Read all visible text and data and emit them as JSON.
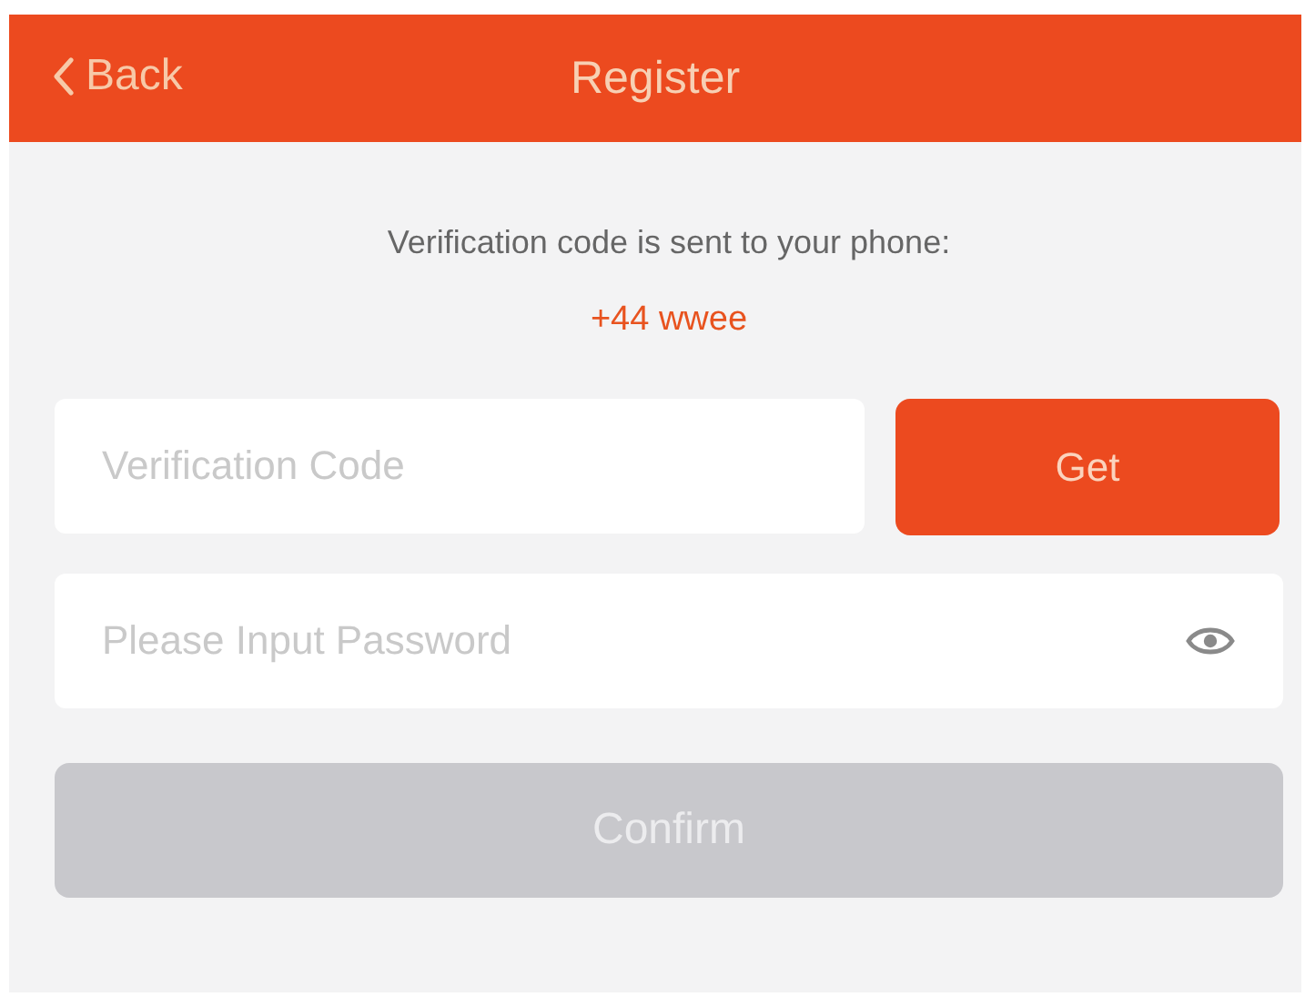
{
  "nav_bar": {
    "back_label": "Back",
    "title": "Register"
  },
  "message": "Verification code is sent to your phone:",
  "phone": "+44 wwee",
  "code_field": {
    "placeholder": "Verification Code"
  },
  "get_button": {
    "label": "Get",
    "disabled": false
  },
  "password_field": {
    "placeholder": "Please Input Password",
    "password_visible": false
  },
  "confirm_button": {
    "label": "Confirm",
    "disabled": true
  }
}
